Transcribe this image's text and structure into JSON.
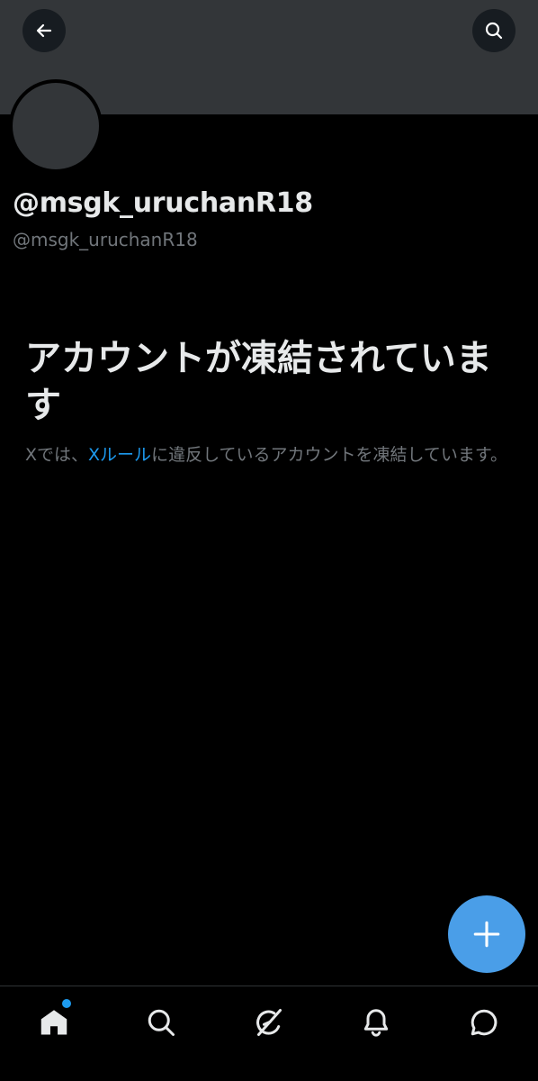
{
  "header": {
    "back_icon": "arrow-left-icon",
    "search_icon": "search-icon",
    "banner_color": "#333639"
  },
  "profile": {
    "display_name": "@msgk_uruchanR18",
    "handle": "@msgk_uruchanR18"
  },
  "suspension": {
    "title": "アカウントが凍結されています",
    "desc_prefix": "Xでは、",
    "rules_link": "Xルール",
    "desc_suffix": "に違反しているアカウントを凍結しています。"
  },
  "fab": {
    "icon": "plus-icon",
    "color": "#4a9ee8"
  },
  "bottom_nav": {
    "items": [
      {
        "icon": "home-icon"
      },
      {
        "icon": "search-icon"
      },
      {
        "icon": "grok-icon"
      },
      {
        "icon": "bell-icon"
      },
      {
        "icon": "messages-icon"
      }
    ],
    "accent": "#1d9bf0"
  }
}
